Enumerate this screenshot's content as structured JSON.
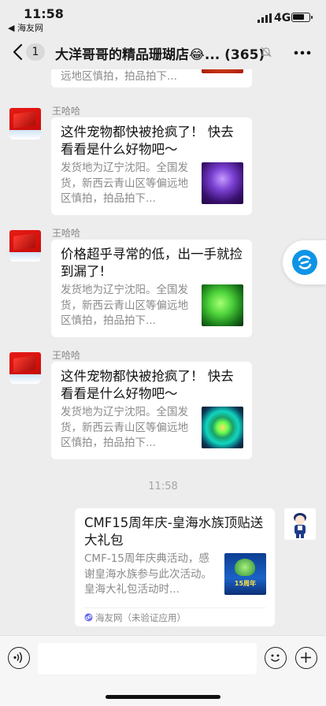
{
  "status_bar": {
    "time": "11:58",
    "back_app": "◀ 海友网",
    "network": "4G",
    "battery_level": 0.7
  },
  "nav": {
    "unread_count": "1",
    "title": "大洋哥哥的精品珊瑚店😂... (365)"
  },
  "messages": [
    {
      "desc_tail": "远地区慎拍，拍品拍下...",
      "thumb": "orange"
    },
    {
      "sender": "王哈哈",
      "title": "这件宠物都快被抢疯了！ 快去看看是什么好物吧～",
      "desc": "发货地为辽宁沈阳。全国发货，新西云青山区等偏远地区慎拍，拍品拍下...",
      "thumb": "purple"
    },
    {
      "sender": "王哈哈",
      "title": "价格超乎寻常的低，出一手就捡到漏了!",
      "desc": "发货地为辽宁沈阳。全国发货，新西云青山区等偏远地区慎拍，拍品拍下...",
      "thumb": "green"
    },
    {
      "sender": "王哈哈",
      "title": "这件宠物都快被抢疯了！ 快去看看是什么好物吧～",
      "desc": "发货地为辽宁沈阳。全国发货，新西云青山区等偏远地区慎拍，拍品拍下...",
      "thumb": "cyan"
    }
  ],
  "timestamp": "11:58",
  "mini_program": {
    "title": "CMF15周年庆-皇海水族顶贴送大礼包",
    "desc": "CMF-15周年庆典活动，感谢皇海水族参与此次活动。皇海大礼包活动时...",
    "thumb_badge": "15周年",
    "source": "海友网（未验证应用）"
  },
  "icons": {
    "back": "chevron-left-icon",
    "mute": "bell-slash-icon",
    "more": "more-dots-icon",
    "voice": "voice-icon",
    "emoji": "emoji-icon",
    "plus": "plus-icon",
    "float": "float-window-icon"
  }
}
